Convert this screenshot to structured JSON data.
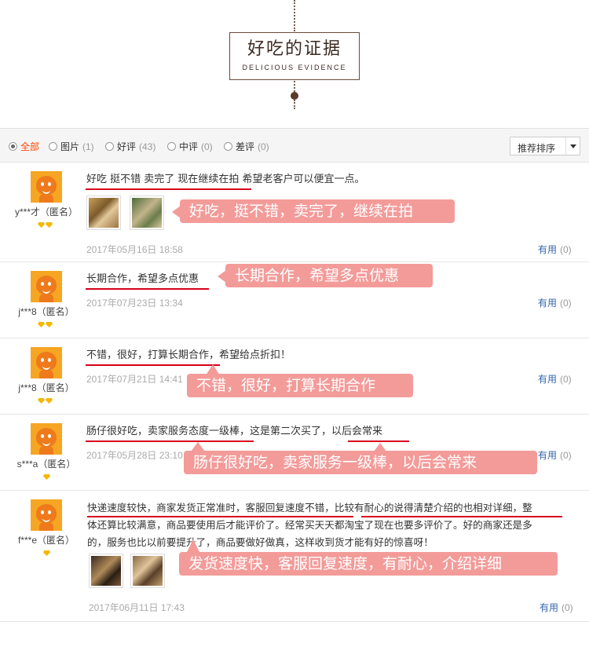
{
  "header": {
    "title_cn": "好吃的证据",
    "title_en": "DELICIOUS EVIDENCE"
  },
  "filter": {
    "options": [
      {
        "label": "全部",
        "count": "",
        "selected": true
      },
      {
        "label": "图片",
        "count": "(1)",
        "selected": false
      },
      {
        "label": "好评",
        "count": "(43)",
        "selected": false
      },
      {
        "label": "中评",
        "count": "(0)",
        "selected": false
      },
      {
        "label": "差评",
        "count": "(0)",
        "selected": false
      }
    ],
    "sort_label": "推荐排序"
  },
  "reviews": [
    {
      "user": "y***才（匿名）",
      "text": "好吃 挺不错 卖完了 现在继续在拍 希望老客户可以便宜一点。",
      "date": "2017年05月16日 18:58",
      "useful_label": "有用",
      "useful_count": "(0)",
      "annotation": "好吃，挺不错，卖完了，继续在拍"
    },
    {
      "user": "j***8（匿名）",
      "text": "长期合作，希望多点优惠",
      "date": "2017年07月23日 13:34",
      "useful_label": "有用",
      "useful_count": "(0)",
      "annotation": "长期合作，希望多点优惠"
    },
    {
      "user": "j***8（匿名）",
      "text": "不错，很好，打算长期合作，希望给点折扣！",
      "date": "2017年07月21日 14:41",
      "useful_label": "有用",
      "useful_count": "(0)",
      "annotation": "不错，很好，打算长期合作"
    },
    {
      "user": "s***a（匿名）",
      "text": "肠仔很好吃，卖家服务态度一级棒，这是第二次买了，以后会常来",
      "date": "2017年05月28日 23:10",
      "useful_label": "有用",
      "useful_count": "(0)",
      "annotation": "肠仔很好吃，卖家服务一级棒，以后会常来"
    },
    {
      "user": "f***e（匿名）",
      "text_lines": [
        "快递速度较快，商家发货正常准时，客服回复速度不错，比较有耐心的说得清楚介绍的也相对详细，整",
        "体还算比较满意，商品要使用后才能评价了。经常买天天都淘宝了现在也要多评价了。好的商家还是多",
        "的，服务也比以前要提升了，商品要做好做真，这样收到货才能有好的惊喜呀！"
      ],
      "date": "2017年06月11日 17:43",
      "useful_label": "有用",
      "useful_count": "(0)",
      "annotation": "发货速度快，客服回复速度，有耐心，介绍详细"
    }
  ]
}
